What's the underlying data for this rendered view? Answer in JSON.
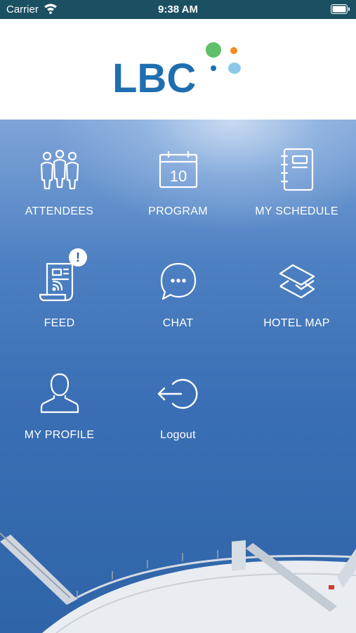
{
  "status_bar": {
    "carrier": "Carrier",
    "time": "9:38 AM",
    "icons": [
      "wifi-icon",
      "battery-icon"
    ]
  },
  "header": {
    "logo_text": "LBC",
    "logo_color": "#1f6fb0",
    "dot_colors": [
      "#5fbf6a",
      "#f28c1e",
      "#1f6fb0",
      "#8cc8ea"
    ]
  },
  "menu": {
    "attendees": "ATTENDEES",
    "program": "PROGRAM",
    "program_day": "10",
    "my_schedule": "MY SCHEDULE",
    "feed": "FEED",
    "feed_badge": "!",
    "chat": "CHAT",
    "hotel_map": "HOTEL MAP",
    "my_profile": "MY PROFILE",
    "logout": "Logout"
  },
  "colors": {
    "background_top": "#7ea4d8",
    "background_bottom": "#2f64a8",
    "status_bar": "#1b4f62",
    "text": "#ffffff"
  }
}
